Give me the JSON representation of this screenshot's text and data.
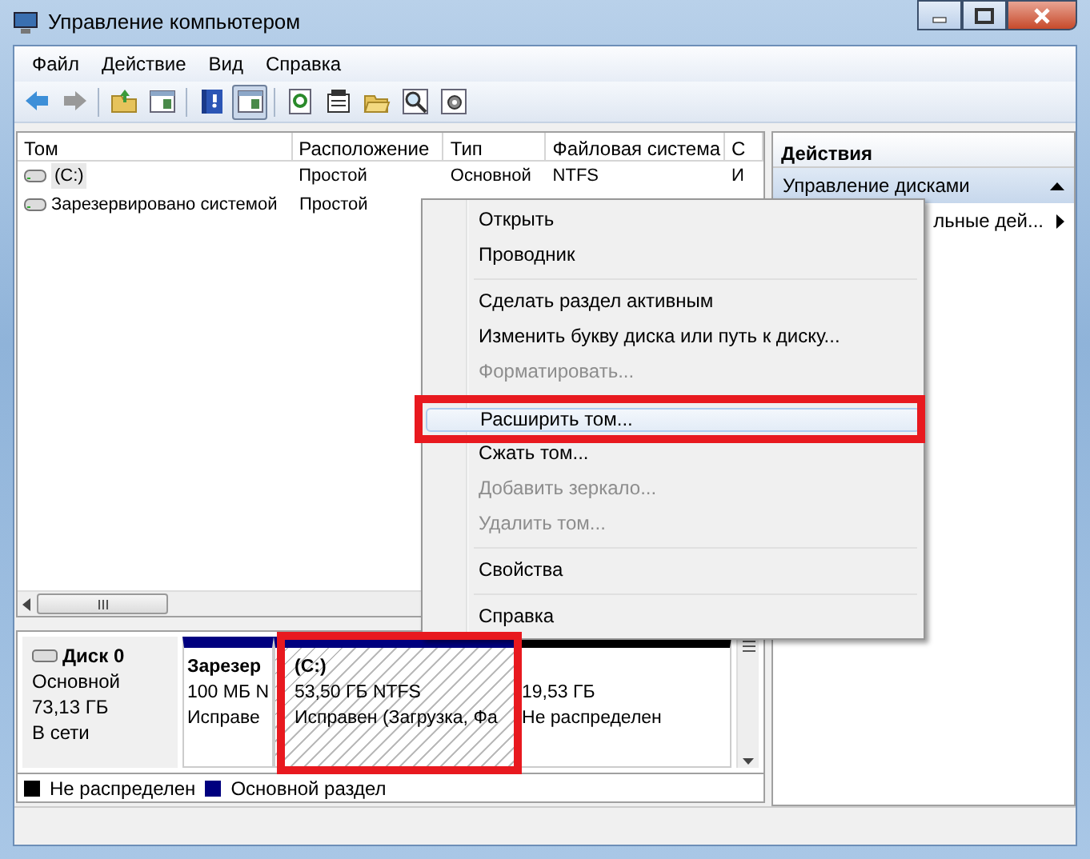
{
  "window": {
    "title": "Управление компьютером"
  },
  "menu": [
    "Файл",
    "Действие",
    "Вид",
    "Справка"
  ],
  "toolbar": [
    {
      "kind": "back",
      "selected": false
    },
    {
      "kind": "forward",
      "selected": false
    },
    {
      "kind": "sep"
    },
    {
      "kind": "folder-up",
      "selected": false
    },
    {
      "kind": "panel",
      "selected": false
    },
    {
      "kind": "sep"
    },
    {
      "kind": "help",
      "selected": false
    },
    {
      "kind": "panel",
      "selected": true
    },
    {
      "kind": "sep"
    },
    {
      "kind": "refresh",
      "selected": false
    },
    {
      "kind": "props",
      "selected": false
    },
    {
      "kind": "open",
      "selected": false
    },
    {
      "kind": "search",
      "selected": false
    },
    {
      "kind": "settings",
      "selected": false
    }
  ],
  "table": {
    "columns": [
      "Том",
      "Расположение",
      "Тип",
      "Файловая система",
      "С"
    ],
    "rows": [
      {
        "cells": [
          "(C:)",
          "Простой",
          "Основной",
          "NTFS",
          "И"
        ],
        "selected": true
      },
      {
        "cells": [
          "Зарезервировано системой",
          "Простой"
        ],
        "selected": false
      }
    ]
  },
  "actions": {
    "title": "Действия",
    "items": [
      {
        "label": "Управление дисками",
        "kind": "header"
      },
      {
        "label": "льные дей...",
        "kind": "submenu"
      }
    ]
  },
  "disk": {
    "name": "Диск 0",
    "type": "Основной",
    "size": "73,13 ГБ",
    "status": "В сети",
    "partitions": [
      {
        "title": "Зарезер",
        "size": "100 МБ N",
        "status": "Исправе",
        "kind": "primary",
        "selected": false
      },
      {
        "title": "(C:)",
        "size": "53,50 ГБ NTFS",
        "status": "Исправен (Загрузка, Фа",
        "kind": "primary",
        "selected": true
      },
      {
        "size": "19,53 ГБ",
        "status": "Не распределен",
        "kind": "unallocated",
        "selected": false
      }
    ]
  },
  "legend": [
    {
      "label": "Не распределен",
      "color": "#000000"
    },
    {
      "label": "Основной раздел",
      "color": "#00007f"
    }
  ],
  "context_menu": [
    {
      "label": "Открыть",
      "kind": "item",
      "disabled": false,
      "selected": false
    },
    {
      "label": "Проводник",
      "kind": "item",
      "disabled": false,
      "selected": false
    },
    {
      "kind": "separator"
    },
    {
      "label": "Сделать раздел активным",
      "kind": "item",
      "disabled": false,
      "selected": false
    },
    {
      "label": "Изменить букву диска или путь к диску...",
      "kind": "item",
      "disabled": false,
      "selected": false
    },
    {
      "label": "Форматировать...",
      "kind": "item",
      "disabled": true,
      "selected": false
    },
    {
      "kind": "separator"
    },
    {
      "label": "Расширить том...",
      "kind": "item",
      "disabled": false,
      "selected": true
    },
    {
      "label": "Сжать том...",
      "kind": "item",
      "disabled": false,
      "selected": false
    },
    {
      "label": "Добавить зеркало...",
      "kind": "item",
      "disabled": true,
      "selected": false
    },
    {
      "label": "Удалить том...",
      "kind": "item",
      "disabled": true,
      "selected": false
    },
    {
      "kind": "separator"
    },
    {
      "label": "Свойства",
      "kind": "item",
      "disabled": false,
      "selected": false
    },
    {
      "kind": "separator"
    },
    {
      "label": "Справка",
      "kind": "item",
      "disabled": false,
      "selected": false
    }
  ]
}
